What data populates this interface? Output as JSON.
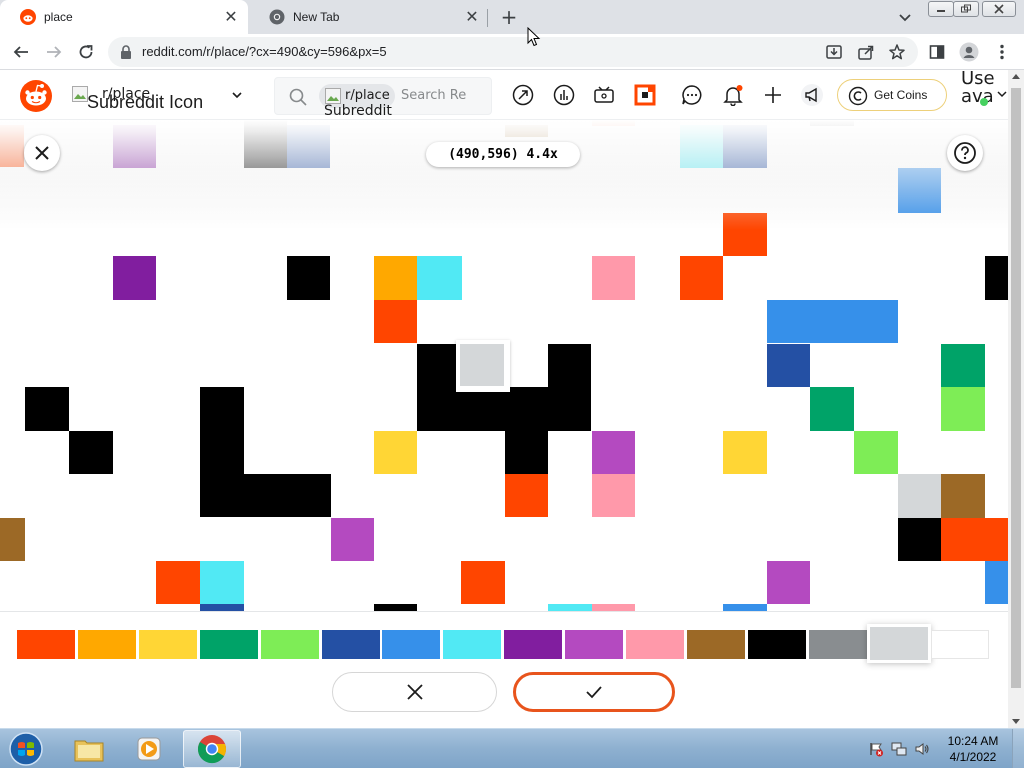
{
  "browser": {
    "tabs": [
      {
        "title": "place",
        "icon": "reddit-favicon-icon",
        "active": true
      },
      {
        "title": "New Tab",
        "icon": "chrome-favicon-icon",
        "active": false
      }
    ],
    "url": "reddit.com/r/place/?cx=490&cy=596&px=5"
  },
  "reddit_header": {
    "community_image_alt": "Subreddit Icon",
    "community_name": "r/place",
    "search_chip_label": "r/place",
    "search_chip_image_alt": "Subreddit Icon",
    "search_placeholder": "Search Reddit",
    "coins_label": "Get Coins",
    "user_alt_line1": "Use",
    "user_alt_line2": "ava"
  },
  "place": {
    "coordinates_label": "(490,596) 4.4x",
    "selected_color": "#D4D7D9",
    "colors": {
      "orange_red": "#FF4500",
      "orange": "#FFA800",
      "yellow": "#FFD635",
      "dark_green": "#00A368",
      "light_green": "#7EED56",
      "dark_blue": "#2450A4",
      "blue": "#3690EA",
      "light_blue": "#51E9F4",
      "dark_purple": "#811E9F",
      "purple": "#B44AC0",
      "pink": "#FF99AA",
      "brown": "#9C6926",
      "black": "#000000",
      "gray": "#898D90",
      "light_gray": "#D4D7D9",
      "white": "#FFFFFF"
    },
    "palette": [
      "#FF4500",
      "#FFA800",
      "#FFD635",
      "#00A368",
      "#7EED56",
      "#2450A4",
      "#3690EA",
      "#51E9F4",
      "#811E9F",
      "#B44AC0",
      "#FF99AA",
      "#9C6926",
      "#000000",
      "#898D90",
      "#D4D7D9",
      "#FFFFFF"
    ]
  },
  "taskbar": {
    "time": "10:24 AM",
    "date": "4/1/2022"
  }
}
